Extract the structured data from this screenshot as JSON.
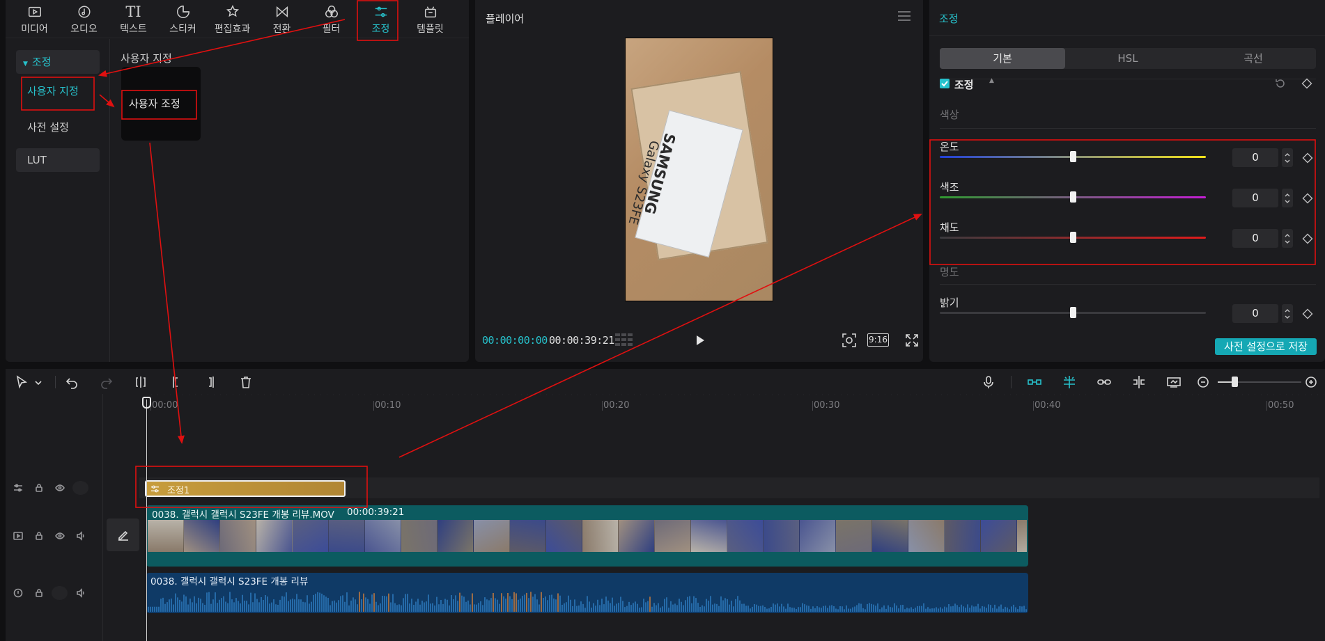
{
  "toolbar": {
    "tabs": [
      {
        "label": "미디어",
        "icon": "media-icon"
      },
      {
        "label": "오디오",
        "icon": "audio-icon"
      },
      {
        "label": "텍스트",
        "icon": "text-icon"
      },
      {
        "label": "스티커",
        "icon": "sticker-icon"
      },
      {
        "label": "편집효과",
        "icon": "effects-icon"
      },
      {
        "label": "전환",
        "icon": "transition-icon"
      },
      {
        "label": "필터",
        "icon": "filter-icon"
      },
      {
        "label": "조정",
        "icon": "adjust-icon",
        "active": true
      },
      {
        "label": "템플릿",
        "icon": "template-icon"
      }
    ],
    "text_icon_glyph": "TI"
  },
  "sidebar": {
    "group": "조정",
    "items": [
      "사용자 지정",
      "사전 설정"
    ],
    "lut": "LUT"
  },
  "custom": {
    "heading": "사용자 지정",
    "card_label": "사용자 조정"
  },
  "player": {
    "title": "플레이어",
    "current_time": "00:00:00:00",
    "total_time": "00:00:39:21",
    "ratio": "9:16",
    "frame_text_brand": "SAMSUNG",
    "frame_text_model": "Galaxy S23FE"
  },
  "adjust": {
    "title": "조정",
    "tabs": [
      "기본",
      "HSL",
      "곡선"
    ],
    "active_tab": 0,
    "section_label": "조정",
    "color_group": "색상",
    "light_group": "명도",
    "sliders": [
      {
        "name": "온도",
        "value": "0",
        "level": 0.5,
        "gradient": [
          "#2140d8",
          "#f2e21a"
        ]
      },
      {
        "name": "색조",
        "value": "0",
        "level": 0.5,
        "gradient": [
          "#2f9a2f",
          "#c41ed4"
        ]
      },
      {
        "name": "채도",
        "value": "0",
        "level": 0.5,
        "gradient": [
          "#3a3a3e",
          "#e01b1b"
        ]
      },
      {
        "name": "밝기",
        "value": "0",
        "level": 0.5,
        "gradient": [
          "#3a3a3e",
          "#3a3a3e"
        ]
      }
    ],
    "save_preset": "사전 설정으로 저장"
  },
  "timeline": {
    "ruler": [
      "00:00",
      "00:10",
      "00:20",
      "00:30",
      "00:40",
      "00:50"
    ],
    "adjust_clip": "조정1",
    "video_clip": {
      "title": "0038. 갤럭시 갤럭시 S23FE 개봉 리뷰.MOV",
      "duration": "00:00:39:21"
    },
    "audio_clip": {
      "title": "0038. 갤럭시 갤럭시 S23FE 개봉 리뷰"
    }
  },
  "colors": {
    "accent": "#27c2cc",
    "annotation": "#e01010",
    "adjust_clip": "#b88c36",
    "video_clip": "#0c5b60",
    "audio_clip": "#0f3a66"
  }
}
